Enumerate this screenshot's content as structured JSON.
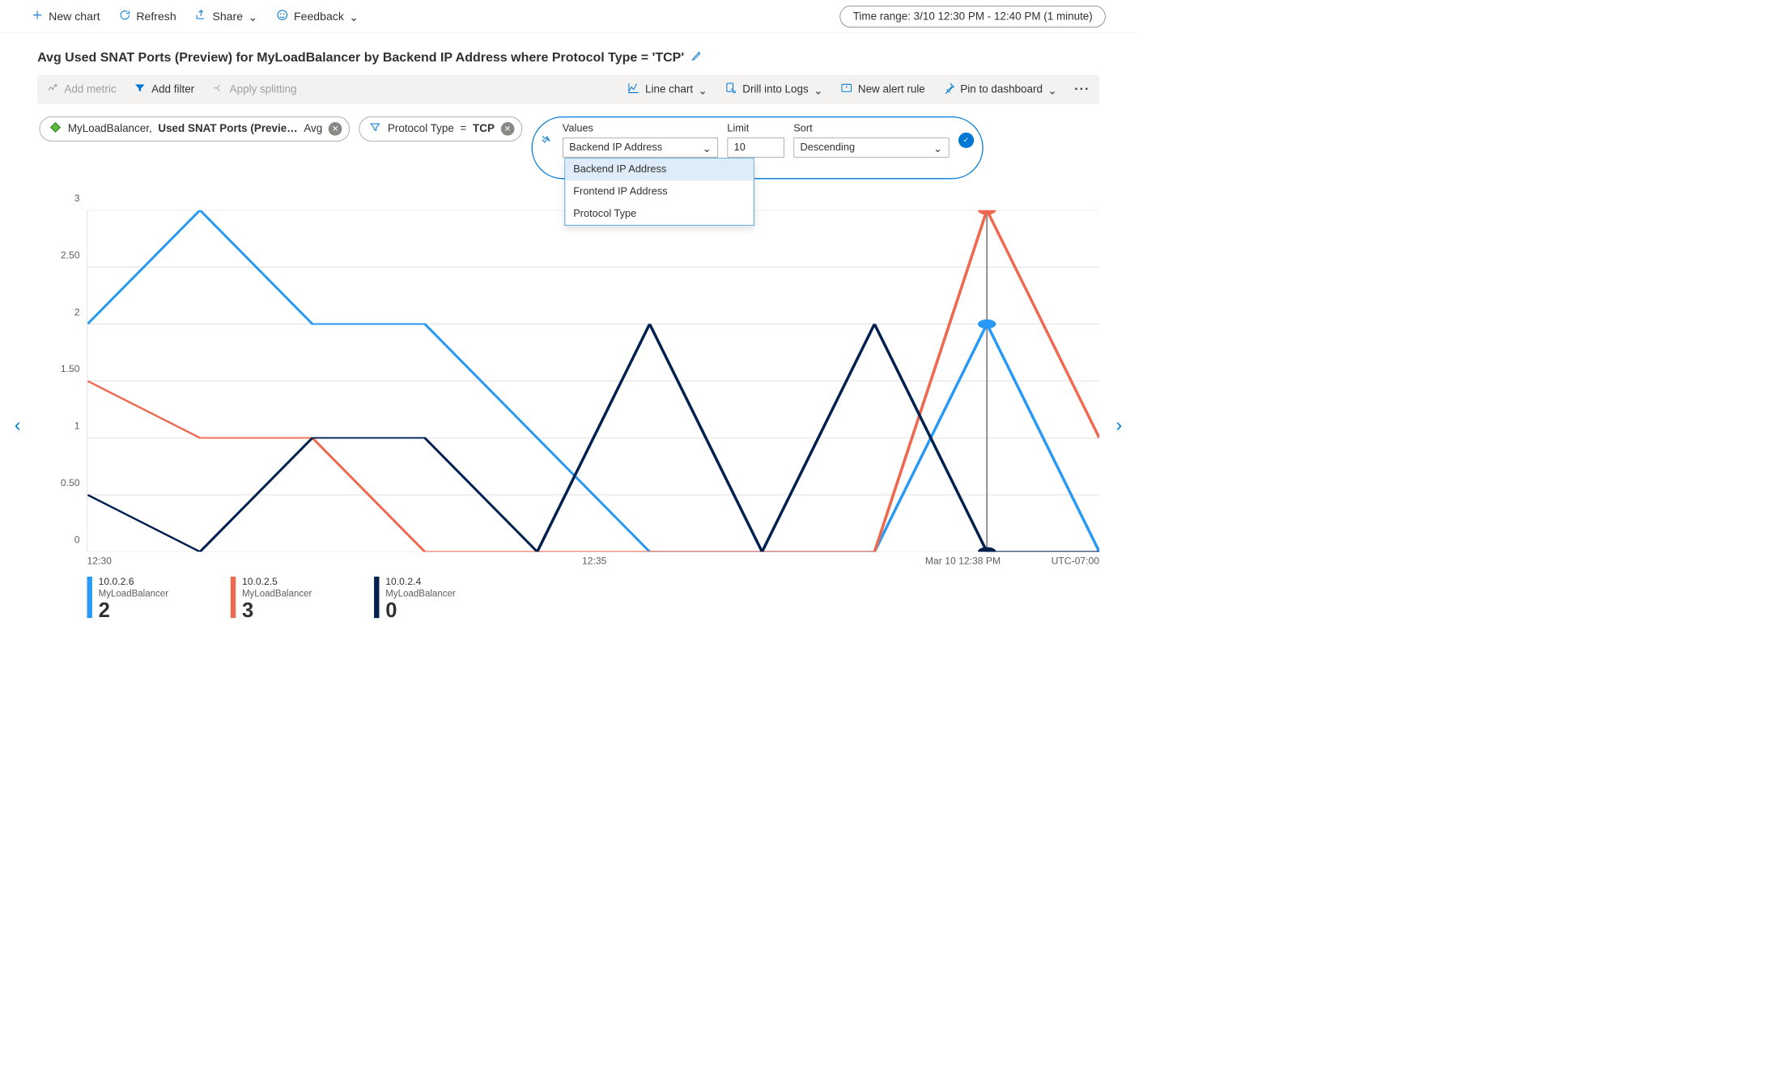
{
  "topbar": {
    "new_chart": "New chart",
    "refresh": "Refresh",
    "share": "Share",
    "feedback": "Feedback",
    "time_range": "Time range: 3/10 12:30 PM - 12:40 PM (1 minute)"
  },
  "chart_title": "Avg Used SNAT Ports (Preview) for MyLoadBalancer by Backend IP Address where Protocol Type = 'TCP'",
  "toolbar2": {
    "add_metric": "Add metric",
    "add_filter": "Add filter",
    "apply_splitting": "Apply splitting",
    "chart_type": "Line chart",
    "drill_logs": "Drill into Logs",
    "new_alert": "New alert rule",
    "pin_dash": "Pin to dashboard"
  },
  "chips": {
    "metric_resource": "MyLoadBalancer,",
    "metric_name": "Used SNAT Ports (Previe…",
    "metric_agg": "Avg",
    "filter_key": "Protocol Type",
    "filter_op": "=",
    "filter_val": "TCP"
  },
  "split": {
    "values_label": "Values",
    "values_sel": "Backend IP Address",
    "limit_label": "Limit",
    "limit_val": "10",
    "sort_label": "Sort",
    "sort_val": "Descending",
    "options": [
      "Backend IP Address",
      "Frontend IP Address",
      "Protocol Type"
    ]
  },
  "xaxis": {
    "t1": "12:30",
    "t2": "12:35",
    "hover": "Mar 10 12:38 PM",
    "tz": "UTC-07:00"
  },
  "yaxis": [
    "0",
    "0.50",
    "1",
    "1.50",
    "2",
    "2.50",
    "3"
  ],
  "legend": [
    {
      "ip": "10.0.2.6",
      "resource": "MyLoadBalancer",
      "value": "2",
      "color": "#2899f5"
    },
    {
      "ip": "10.0.2.5",
      "resource": "MyLoadBalancer",
      "value": "3",
      "color": "#ef6950"
    },
    {
      "ip": "10.0.2.4",
      "resource": "MyLoadBalancer",
      "value": "0",
      "color": "#002050"
    }
  ],
  "chart_data": {
    "type": "line",
    "title": "Avg Used SNAT Ports (Preview) for MyLoadBalancer by Backend IP Address where Protocol Type = 'TCP'",
    "ylabel": "Avg Used SNAT Ports",
    "ylim": [
      0,
      3
    ],
    "x_minutes": [
      0,
      1,
      2,
      3,
      4,
      5,
      6,
      7,
      8,
      9
    ],
    "x_label_start": "12:30",
    "x_label_mid": "12:35",
    "hover_x": 8,
    "series": [
      {
        "name": "10.0.2.6",
        "color": "#2899f5",
        "values": [
          2,
          3,
          2,
          2,
          1,
          0,
          0,
          0,
          2,
          0
        ]
      },
      {
        "name": "10.0.2.5",
        "color": "#ef6950",
        "values": [
          1.5,
          1,
          1,
          0,
          0,
          0,
          0,
          0,
          3,
          1
        ]
      },
      {
        "name": "10.0.2.4",
        "color": "#002050",
        "values": [
          0.5,
          0,
          1,
          1,
          0,
          2,
          0,
          2,
          0,
          0
        ]
      }
    ]
  }
}
